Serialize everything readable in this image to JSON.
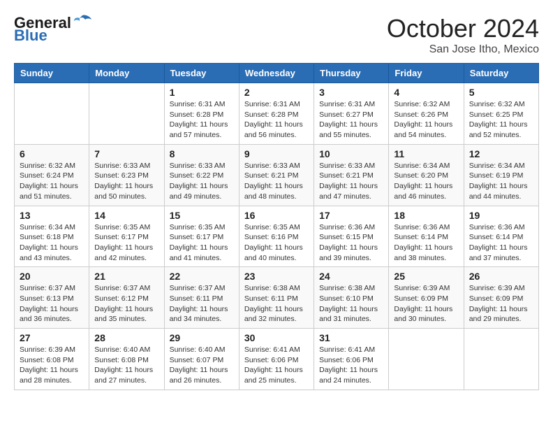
{
  "logo": {
    "general": "General",
    "blue": "Blue"
  },
  "header": {
    "month": "October 2024",
    "location": "San Jose Itho, Mexico"
  },
  "weekdays": [
    "Sunday",
    "Monday",
    "Tuesday",
    "Wednesday",
    "Thursday",
    "Friday",
    "Saturday"
  ],
  "weeks": [
    [
      {
        "day": "",
        "info": ""
      },
      {
        "day": "",
        "info": ""
      },
      {
        "day": "1",
        "info": "Sunrise: 6:31 AM\nSunset: 6:28 PM\nDaylight: 11 hours and 57 minutes."
      },
      {
        "day": "2",
        "info": "Sunrise: 6:31 AM\nSunset: 6:28 PM\nDaylight: 11 hours and 56 minutes."
      },
      {
        "day": "3",
        "info": "Sunrise: 6:31 AM\nSunset: 6:27 PM\nDaylight: 11 hours and 55 minutes."
      },
      {
        "day": "4",
        "info": "Sunrise: 6:32 AM\nSunset: 6:26 PM\nDaylight: 11 hours and 54 minutes."
      },
      {
        "day": "5",
        "info": "Sunrise: 6:32 AM\nSunset: 6:25 PM\nDaylight: 11 hours and 52 minutes."
      }
    ],
    [
      {
        "day": "6",
        "info": "Sunrise: 6:32 AM\nSunset: 6:24 PM\nDaylight: 11 hours and 51 minutes."
      },
      {
        "day": "7",
        "info": "Sunrise: 6:33 AM\nSunset: 6:23 PM\nDaylight: 11 hours and 50 minutes."
      },
      {
        "day": "8",
        "info": "Sunrise: 6:33 AM\nSunset: 6:22 PM\nDaylight: 11 hours and 49 minutes."
      },
      {
        "day": "9",
        "info": "Sunrise: 6:33 AM\nSunset: 6:21 PM\nDaylight: 11 hours and 48 minutes."
      },
      {
        "day": "10",
        "info": "Sunrise: 6:33 AM\nSunset: 6:21 PM\nDaylight: 11 hours and 47 minutes."
      },
      {
        "day": "11",
        "info": "Sunrise: 6:34 AM\nSunset: 6:20 PM\nDaylight: 11 hours and 46 minutes."
      },
      {
        "day": "12",
        "info": "Sunrise: 6:34 AM\nSunset: 6:19 PM\nDaylight: 11 hours and 44 minutes."
      }
    ],
    [
      {
        "day": "13",
        "info": "Sunrise: 6:34 AM\nSunset: 6:18 PM\nDaylight: 11 hours and 43 minutes."
      },
      {
        "day": "14",
        "info": "Sunrise: 6:35 AM\nSunset: 6:17 PM\nDaylight: 11 hours and 42 minutes."
      },
      {
        "day": "15",
        "info": "Sunrise: 6:35 AM\nSunset: 6:17 PM\nDaylight: 11 hours and 41 minutes."
      },
      {
        "day": "16",
        "info": "Sunrise: 6:35 AM\nSunset: 6:16 PM\nDaylight: 11 hours and 40 minutes."
      },
      {
        "day": "17",
        "info": "Sunrise: 6:36 AM\nSunset: 6:15 PM\nDaylight: 11 hours and 39 minutes."
      },
      {
        "day": "18",
        "info": "Sunrise: 6:36 AM\nSunset: 6:14 PM\nDaylight: 11 hours and 38 minutes."
      },
      {
        "day": "19",
        "info": "Sunrise: 6:36 AM\nSunset: 6:14 PM\nDaylight: 11 hours and 37 minutes."
      }
    ],
    [
      {
        "day": "20",
        "info": "Sunrise: 6:37 AM\nSunset: 6:13 PM\nDaylight: 11 hours and 36 minutes."
      },
      {
        "day": "21",
        "info": "Sunrise: 6:37 AM\nSunset: 6:12 PM\nDaylight: 11 hours and 35 minutes."
      },
      {
        "day": "22",
        "info": "Sunrise: 6:37 AM\nSunset: 6:11 PM\nDaylight: 11 hours and 34 minutes."
      },
      {
        "day": "23",
        "info": "Sunrise: 6:38 AM\nSunset: 6:11 PM\nDaylight: 11 hours and 32 minutes."
      },
      {
        "day": "24",
        "info": "Sunrise: 6:38 AM\nSunset: 6:10 PM\nDaylight: 11 hours and 31 minutes."
      },
      {
        "day": "25",
        "info": "Sunrise: 6:39 AM\nSunset: 6:09 PM\nDaylight: 11 hours and 30 minutes."
      },
      {
        "day": "26",
        "info": "Sunrise: 6:39 AM\nSunset: 6:09 PM\nDaylight: 11 hours and 29 minutes."
      }
    ],
    [
      {
        "day": "27",
        "info": "Sunrise: 6:39 AM\nSunset: 6:08 PM\nDaylight: 11 hours and 28 minutes."
      },
      {
        "day": "28",
        "info": "Sunrise: 6:40 AM\nSunset: 6:08 PM\nDaylight: 11 hours and 27 minutes."
      },
      {
        "day": "29",
        "info": "Sunrise: 6:40 AM\nSunset: 6:07 PM\nDaylight: 11 hours and 26 minutes."
      },
      {
        "day": "30",
        "info": "Sunrise: 6:41 AM\nSunset: 6:06 PM\nDaylight: 11 hours and 25 minutes."
      },
      {
        "day": "31",
        "info": "Sunrise: 6:41 AM\nSunset: 6:06 PM\nDaylight: 11 hours and 24 minutes."
      },
      {
        "day": "",
        "info": ""
      },
      {
        "day": "",
        "info": ""
      }
    ]
  ]
}
